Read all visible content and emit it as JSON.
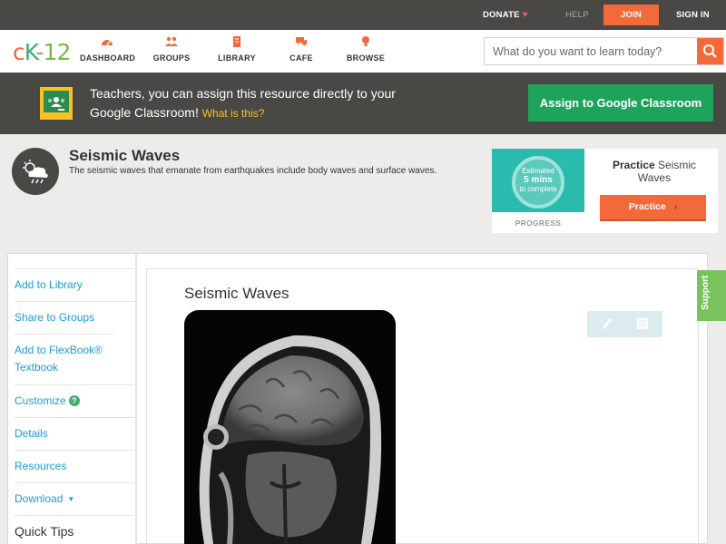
{
  "topbar": {
    "donate": "DONATE",
    "help": "HELP",
    "join": "JOIN",
    "signin": "SIGN IN"
  },
  "nav": {
    "logo_c": "c",
    "logo_k": "K",
    "logo_rest": "-12",
    "items": [
      {
        "label": "DASHBOARD",
        "icon": "dashboard-icon"
      },
      {
        "label": "GROUPS",
        "icon": "groups-icon"
      },
      {
        "label": "LIBRARY",
        "icon": "library-icon"
      },
      {
        "label": "CAFE",
        "icon": "cafe-icon"
      },
      {
        "label": "BROWSE",
        "icon": "browse-icon"
      }
    ],
    "search_placeholder": "What do you want to learn today?"
  },
  "classroom": {
    "text": "Teachers, you can assign this resource directly to your Google Classroom!",
    "what": "What is this?",
    "button": "Assign to Google Classroom"
  },
  "concept": {
    "title": "Seismic Waves",
    "description": "The seismic waves that emanate from earthquakes include body waves and surface waves."
  },
  "practice": {
    "estimated": "Estimated",
    "mins": "5 mins",
    "to_complete": "to complete",
    "progress_label": "PROGRESS",
    "title_bold": "Practice",
    "title_rest": "Seismic Waves",
    "button": "Practice"
  },
  "sidebar": {
    "items": [
      "Add to Library",
      "Share to Groups",
      "Add to FlexBook® Textbook",
      "Customize",
      "Details",
      "Resources",
      "Download"
    ],
    "quick_tips": "Quick Tips"
  },
  "main": {
    "title": "Seismic Waves"
  },
  "support": "Support",
  "colors": {
    "accent": "#f26a3a",
    "dark": "#4a4845",
    "green": "#1fa35b",
    "link": "#1a9bd7"
  }
}
